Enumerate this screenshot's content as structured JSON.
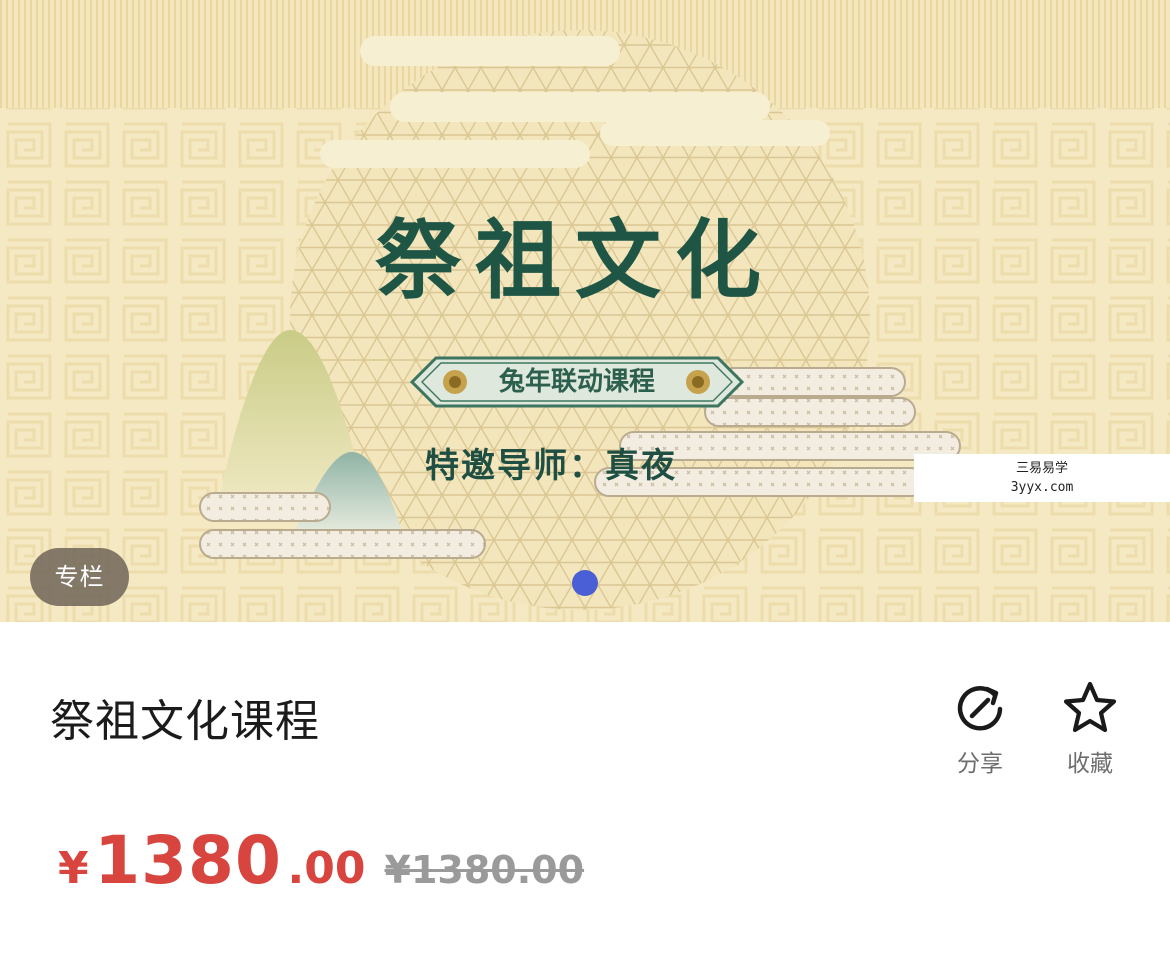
{
  "banner": {
    "title": "祭祖文化",
    "ribbon": "兔年联动课程",
    "mentor": "特邀导师：真夜",
    "watermark_line1": "三易易学",
    "watermark_line2": "3yyx.com",
    "badge": "专栏"
  },
  "course": {
    "title": "祭祖文化课程",
    "price_currency": "¥",
    "price_integer": "1380",
    "price_decimal": ".00",
    "original_price": "¥1380.00"
  },
  "actions": {
    "share_label": "分享",
    "share_icon": "share-icon",
    "favorite_label": "收藏",
    "favorite_icon": "star-icon"
  },
  "colors": {
    "banner_bg": "#f6ebc6",
    "title_green": "#1e5544",
    "price_red": "#d8443e",
    "dot_blue": "#4a5fd6"
  }
}
